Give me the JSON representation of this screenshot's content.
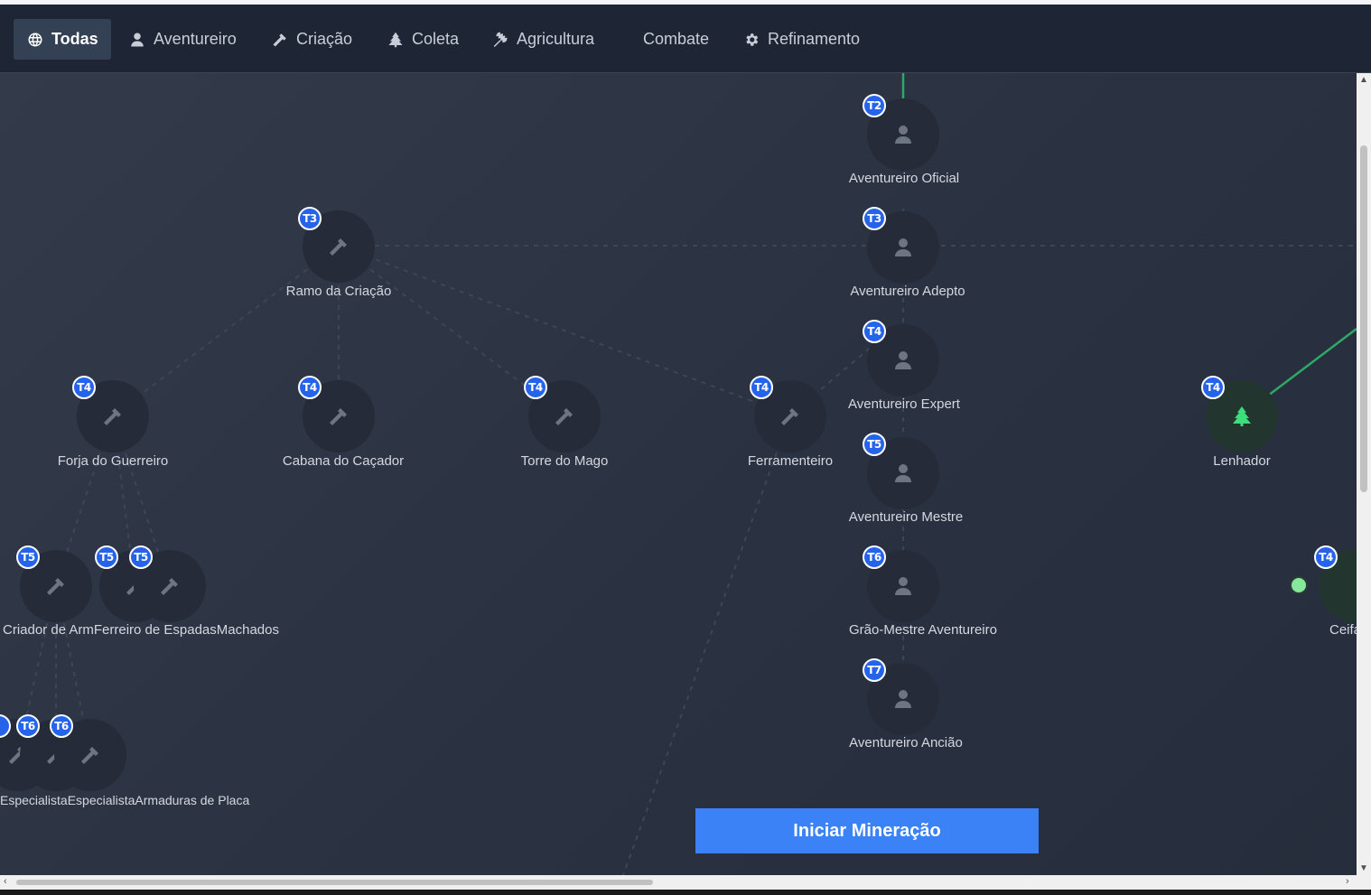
{
  "tabs": [
    {
      "label": "Todas",
      "icon": "globe-icon",
      "active": true
    },
    {
      "label": "Aventureiro",
      "icon": "user-icon"
    },
    {
      "label": "Criação",
      "icon": "hammer-icon"
    },
    {
      "label": "Coleta",
      "icon": "tree-icon"
    },
    {
      "label": "Agricultura",
      "icon": "wheat-icon"
    },
    {
      "label": "Combate",
      "icon": ""
    },
    {
      "label": "Refinamento",
      "icon": "gear-icon"
    }
  ],
  "nodes": {
    "aventureiro_oficial": {
      "tier": "T2",
      "label": "Aventureiro Oficial",
      "icon": "user-icon"
    },
    "aventureiro_adepto": {
      "tier": "T3",
      "label": "Aventureiro Adepto",
      "icon": "user-icon"
    },
    "aventureiro_expert": {
      "tier": "T4",
      "label": "Aventureiro Expert",
      "icon": "user-icon"
    },
    "aventureiro_mestre": {
      "tier": "T5",
      "label": "Aventureiro Mestre",
      "icon": "user-icon"
    },
    "grao_mestre": {
      "tier": "T6",
      "label": "Grão-Mestre Aventureiro",
      "icon": "user-icon"
    },
    "aventureiro_anciao": {
      "tier": "T7",
      "label": "Aventureiro Ancião",
      "icon": "user-icon"
    },
    "ramo_criacao": {
      "tier": "T3",
      "label": "Ramo da Criação",
      "icon": "hammer-icon"
    },
    "forja_guerreiro": {
      "tier": "T4",
      "label": "Forja do Guerreiro",
      "icon": "hammer-icon"
    },
    "cabana_cacador": {
      "tier": "T4",
      "label": "Cabana do Caçador",
      "icon": "hammer-icon"
    },
    "torre_mago": {
      "tier": "T4",
      "label": "Torre do Mago",
      "icon": "hammer-icon"
    },
    "ferramenteiro": {
      "tier": "T4",
      "label": "Ferramenteiro",
      "icon": "hammer-icon"
    },
    "lenhador": {
      "tier": "T4",
      "label": "Lenhador",
      "icon": "tree-icon"
    },
    "ceifador": {
      "tier": "T4",
      "label": "Ceifa",
      "icon": "tree-icon"
    },
    "t5_a": {
      "tier": "T5",
      "icon": "hammer-icon"
    },
    "t5_b": {
      "tier": "T5",
      "icon": "hammer-icon"
    },
    "t5_c": {
      "tier": "T5",
      "icon": "hammer-icon"
    },
    "t6_a": {
      "tier": "T6",
      "icon": "hammer-icon"
    },
    "t6_b": {
      "tier": "T6",
      "icon": "hammer-icon"
    },
    "t6_c": {
      "tier": "T6",
      "icon": "hammer-icon"
    }
  },
  "overlap_labels": {
    "t5_row": "Criador de ArmFerreiro de EspadasMachados",
    "t6_row": "EspecialistaEspecialistaArmaduras de Placa"
  },
  "cta": {
    "label": "Iniciar Mineração"
  },
  "colors": {
    "accent": "#3b82f6",
    "badge": "#2563eb",
    "unlocked": "#3ddc7c",
    "link_active": "#2fa865"
  }
}
